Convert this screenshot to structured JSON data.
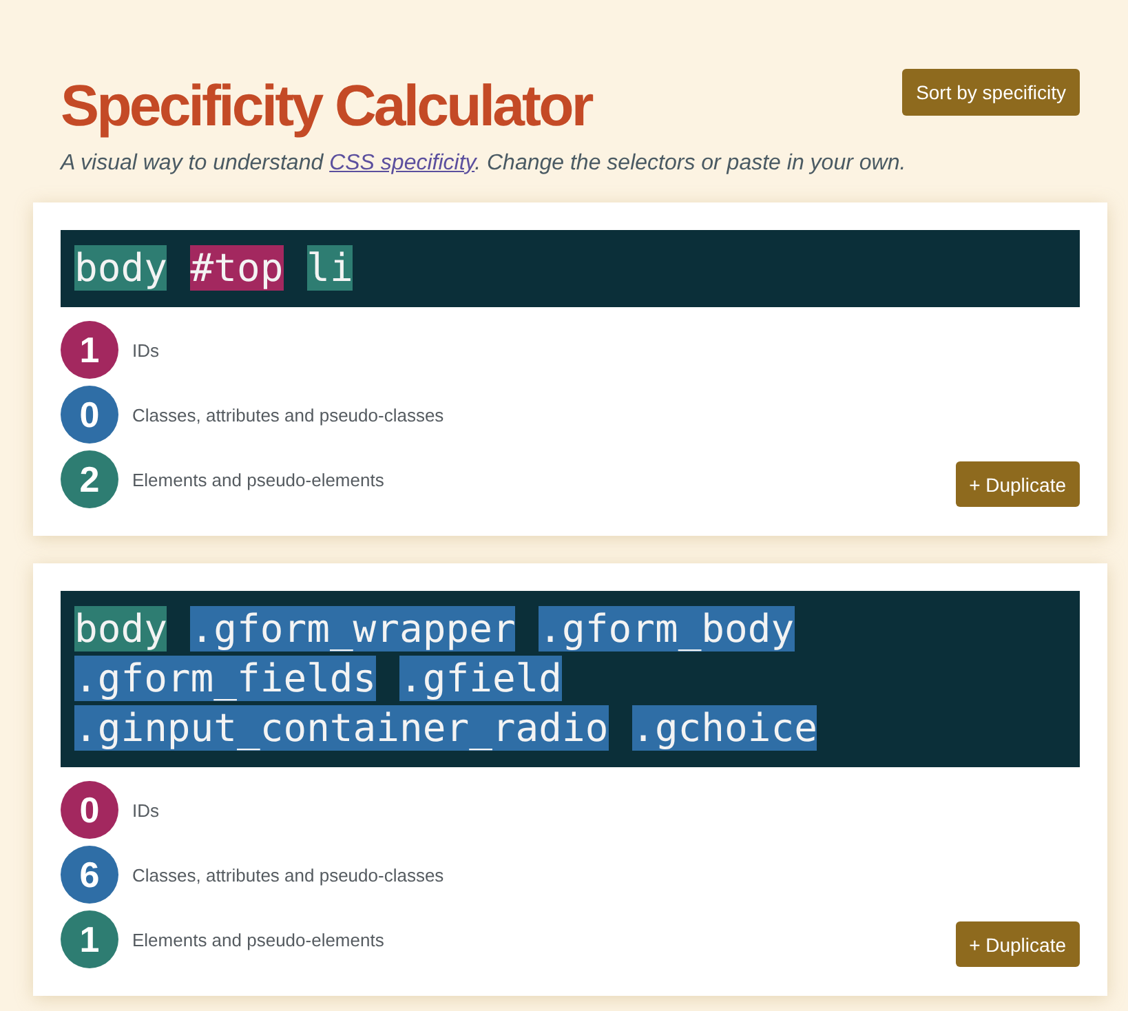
{
  "header": {
    "title": "Specificity Calculator",
    "sort_button": "Sort by specificity",
    "subtitle": {
      "before": "A visual way to understand ",
      "link": "CSS specificity",
      "after": ". Change the selectors or paste in your own."
    }
  },
  "selectors": [
    {
      "tokens": [
        {
          "text": "body",
          "kind": "element"
        },
        {
          "text": "#top",
          "kind": "id"
        },
        {
          "text": "li",
          "kind": "element"
        }
      ],
      "counts": [
        {
          "value": "1",
          "label": "IDs",
          "kind": "id"
        },
        {
          "value": "0",
          "label": "Classes, attributes and pseudo-classes",
          "kind": "class"
        },
        {
          "value": "2",
          "label": "Elements and pseudo-elements",
          "kind": "element"
        }
      ],
      "duplicate_button": "+ Duplicate"
    },
    {
      "tokens": [
        {
          "text": "body",
          "kind": "element"
        },
        {
          "text": ".gform_wrapper",
          "kind": "class"
        },
        {
          "text": ".gform_body",
          "kind": "class"
        },
        {
          "text": ".gform_fields",
          "kind": "class"
        },
        {
          "text": ".gfield",
          "kind": "class"
        },
        {
          "text": ".ginput_container_radio",
          "kind": "class"
        },
        {
          "text": ".gchoice",
          "kind": "class"
        }
      ],
      "counts": [
        {
          "value": "0",
          "label": "IDs",
          "kind": "id"
        },
        {
          "value": "6",
          "label": "Classes, attributes and pseudo-classes",
          "kind": "class"
        },
        {
          "value": "1",
          "label": "Elements and pseudo-elements",
          "kind": "element"
        }
      ],
      "duplicate_button": "+ Duplicate"
    }
  ]
}
